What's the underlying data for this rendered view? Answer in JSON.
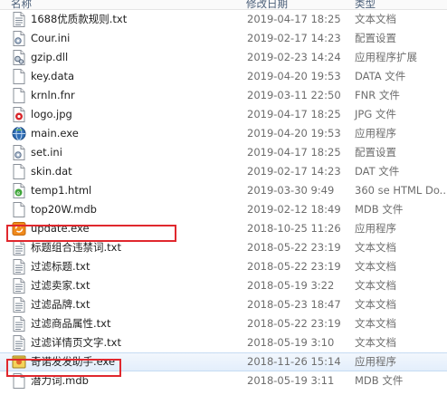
{
  "columns": {
    "name": "名称",
    "date": "修改日期",
    "type": "类型"
  },
  "files": [
    {
      "name": "1688优质款规则.txt",
      "date": "2019-04-17 18:25",
      "type": "文本文档",
      "icon": "text-file-icon"
    },
    {
      "name": "Cour.ini",
      "date": "2019-02-17 14:23",
      "type": "配置设置",
      "icon": "config-file-icon"
    },
    {
      "name": "gzip.dll",
      "date": "2019-02-23 14:24",
      "type": "应用程序扩展",
      "icon": "dll-file-icon"
    },
    {
      "name": "key.data",
      "date": "2019-04-20 19:53",
      "type": "DATA 文件",
      "icon": "blank-file-icon"
    },
    {
      "name": "krnln.fnr",
      "date": "2019-03-11 22:50",
      "type": "FNR 文件",
      "icon": "blank-file-icon"
    },
    {
      "name": "logo.jpg",
      "date": "2019-04-17 18:25",
      "type": "JPG 文件",
      "icon": "image-file-icon"
    },
    {
      "name": "main.exe",
      "date": "2019-04-20 19:53",
      "type": "应用程序",
      "icon": "app-globe-icon"
    },
    {
      "name": "set.ini",
      "date": "2019-04-17 18:25",
      "type": "配置设置",
      "icon": "config-file-icon"
    },
    {
      "name": "skin.dat",
      "date": "2019-02-17 14:23",
      "type": "DAT 文件",
      "icon": "blank-file-icon"
    },
    {
      "name": "temp1.html",
      "date": "2019-03-30 9:49",
      "type": "360 se HTML Do...",
      "icon": "html-file-icon"
    },
    {
      "name": "top20W.mdb",
      "date": "2019-02-12 18:49",
      "type": "MDB 文件",
      "icon": "blank-file-icon"
    },
    {
      "name": "update.exe",
      "date": "2018-10-25 11:26",
      "type": "应用程序",
      "icon": "update-app-icon"
    },
    {
      "name": "标题组合违禁词.txt",
      "date": "2018-05-22 23:19",
      "type": "文本文档",
      "icon": "text-file-icon"
    },
    {
      "name": "过滤标题.txt",
      "date": "2018-05-22 23:19",
      "type": "文本文档",
      "icon": "text-file-icon"
    },
    {
      "name": "过滤卖家.txt",
      "date": "2018-05-19 3:22",
      "type": "文本文档",
      "icon": "text-file-icon"
    },
    {
      "name": "过滤品牌.txt",
      "date": "2018-05-23 18:47",
      "type": "文本文档",
      "icon": "text-file-icon"
    },
    {
      "name": "过滤商品属性.txt",
      "date": "2018-05-22 23:19",
      "type": "文本文档",
      "icon": "text-file-icon"
    },
    {
      "name": "过滤详情页文字.txt",
      "date": "2018-05-19 3:10",
      "type": "文本文档",
      "icon": "text-file-icon"
    },
    {
      "name": "奇诺发发助手.exe",
      "date": "2018-11-26 15:14",
      "type": "应用程序",
      "icon": "helper-app-icon",
      "selected": true
    },
    {
      "name": "潜力词.mdb",
      "date": "2018-05-19 3:11",
      "type": "MDB 文件",
      "icon": "blank-file-icon"
    }
  ],
  "colors": {
    "highlight": "#e0282e",
    "selection": "#e3eefb"
  }
}
